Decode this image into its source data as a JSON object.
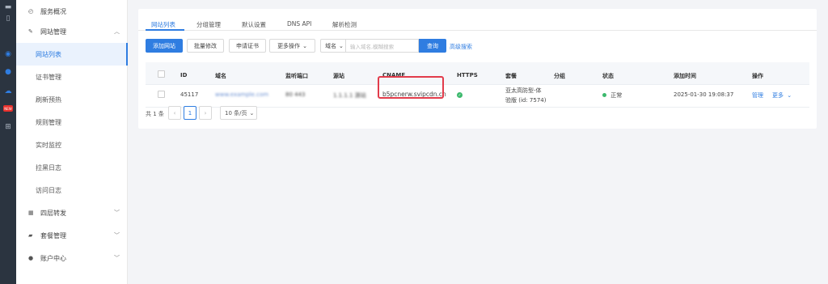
{
  "sidebar": {
    "items": [
      {
        "label": "服务概况",
        "icon": "dashboard-icon"
      },
      {
        "label": "网站管理",
        "icon": "site-icon"
      },
      {
        "label": "网站列表"
      },
      {
        "label": "证书管理"
      },
      {
        "label": "刷新预热"
      },
      {
        "label": "规则管理"
      },
      {
        "label": "实时监控"
      },
      {
        "label": "拉黑日志"
      },
      {
        "label": "访问日志"
      },
      {
        "label": "四层转发",
        "icon": "forward-icon"
      },
      {
        "label": "套餐管理",
        "icon": "package-icon"
      },
      {
        "label": "账户中心",
        "icon": "user-icon"
      }
    ]
  },
  "tabs": [
    "网站列表",
    "分组管理",
    "默认设置",
    "DNS API",
    "解析检测"
  ],
  "toolbar": {
    "add_site": "添加网站",
    "batch_edit": "批量修改",
    "apply_cert": "申请证书",
    "more_ops": "更多操作",
    "domain_select": "域名",
    "search_placeholder": "输入域名,模糊搜索",
    "search_btn": "查询",
    "advanced": "高级搜索"
  },
  "table": {
    "headers": [
      "ID",
      "域名",
      "监听端口",
      "源站",
      "CNAME",
      "HTTPS",
      "套餐",
      "分组",
      "状态",
      "添加时间",
      "操作"
    ],
    "rows": [
      {
        "id": "45117",
        "domain": "www.example.com",
        "port": "80 443",
        "origin": "1.1.1.1 源站",
        "cname": "b5pcnerw.svipcdn.cn",
        "plan_line1": "亚太高防型-体",
        "plan_line2": "验版 (id: 7574)",
        "group": "",
        "status": "正常",
        "added": "2025-01-30 19:08:37",
        "manage": "管理",
        "more": "更多"
      }
    ]
  },
  "pagination": {
    "total": "共 1 条",
    "current": "1",
    "page_size": "10 条/页"
  },
  "colors": {
    "primary": "#2f7de1",
    "success": "#3cb96d",
    "highlight": "#e23c4b"
  }
}
